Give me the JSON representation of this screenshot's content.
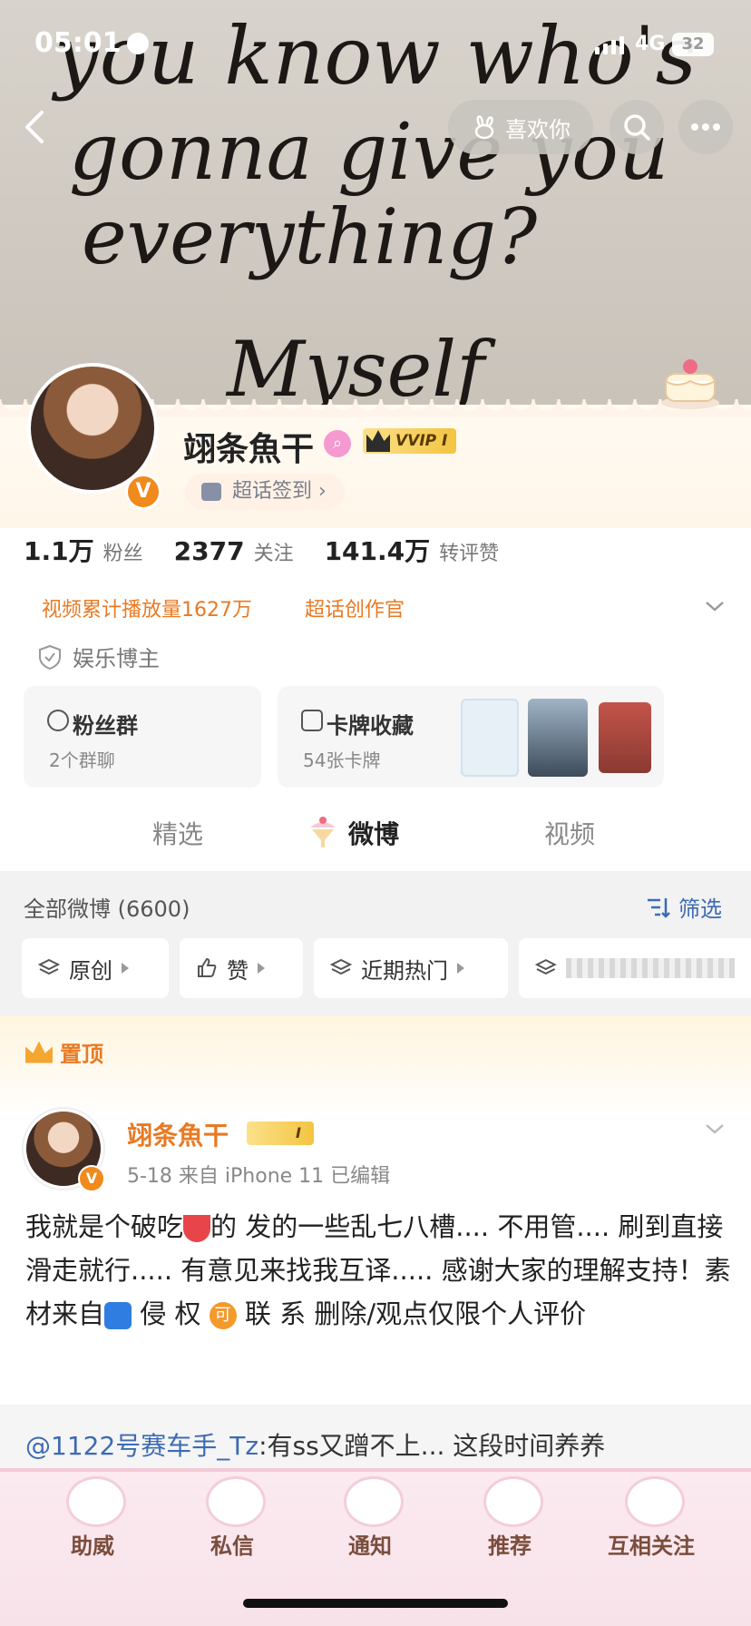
{
  "status": {
    "time": "05:01",
    "network": "4G",
    "battery": "32"
  },
  "banner": {
    "handwriting": [
      "you know who's",
      "gonna give you",
      "everything?",
      "Myself"
    ]
  },
  "header": {
    "like_label": "喜欢你"
  },
  "profile": {
    "name": "翊条魚干",
    "vip_label": "VVIP I",
    "vbadge": "V",
    "checkin_label": "超话签到 ›"
  },
  "stats": [
    {
      "num": "1.1万",
      "label": "粉丝"
    },
    {
      "num": "2377",
      "label": "关注"
    },
    {
      "num": "141.4万",
      "label": "转评赞"
    }
  ],
  "tags": {
    "views": "视频累计播放量1627万",
    "role": "超话创作官"
  },
  "identity": "娱乐博主",
  "cards": {
    "fans": {
      "title": "粉丝群",
      "sub": "2个群聊"
    },
    "collect": {
      "title": "卡牌收藏",
      "sub": "54张卡牌"
    }
  },
  "tabs": [
    "精选",
    "微博",
    "视频"
  ],
  "feed": {
    "title": "全部微博 (6600)",
    "filter_label": "筛选",
    "chips": [
      "原创",
      "赞",
      "近期热门"
    ]
  },
  "pinned": {
    "label": "置顶",
    "name": "翊条魚干",
    "badge_label": "I",
    "meta": "5-18  来自 iPhone 11  已编辑",
    "body_parts": [
      "我就是个破吃",
      "的 发的一些乱七八槽.... 不用管.... 刷到直接滑走就行..... 有意见来找我互译..... 感谢大家的理解支持！素材来自",
      " 侵 权 ",
      " 联 系 删除/观点仅限个人评价"
    ],
    "emoji": {
      "watermelon": "#e8454a",
      "wifi": "#2f7de1",
      "orange_dot": "#f39a2b"
    },
    "emoji_text": "可"
  },
  "quote": {
    "at": "@1122号赛车手_Tz",
    "text": ":有ss又蹭不上... 这段时间养养"
  },
  "nav": [
    "助威",
    "私信",
    "通知",
    "推荐",
    "互相关注"
  ]
}
